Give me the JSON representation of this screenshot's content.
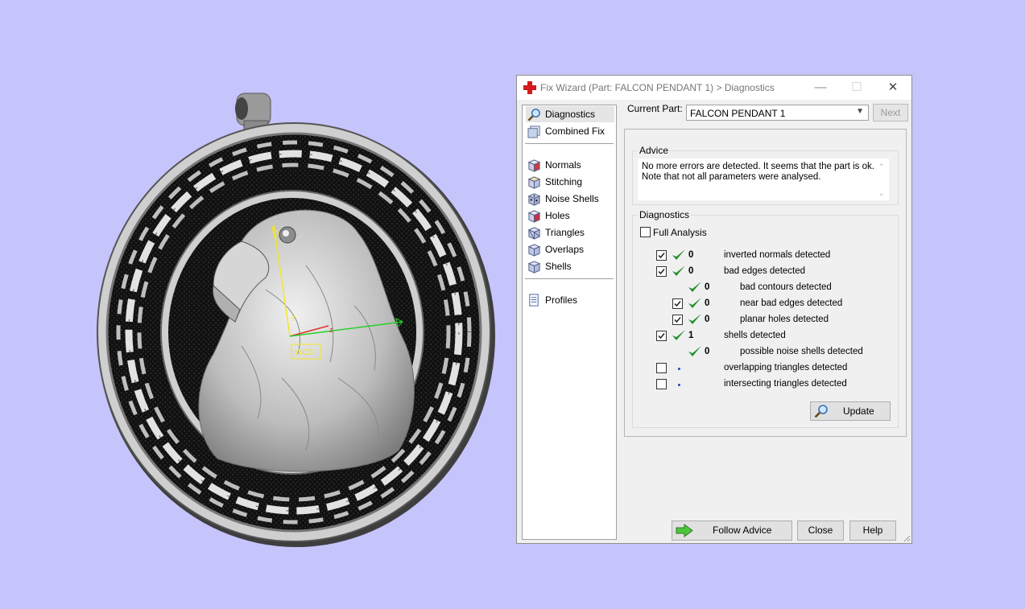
{
  "viewport": {
    "axis_label": "WCS",
    "colors": {
      "background": "#c5c4fb",
      "axis_x": "#e03030",
      "axis_y": "#f2e62a",
      "axis_z": "#29d029"
    }
  },
  "dialog": {
    "title": "Fix Wizard (Part: FALCON PENDANT 1) > Diagnostics",
    "window_buttons": {
      "minimize": "—",
      "maximize": "☐",
      "close": "✕"
    },
    "sidebar": {
      "items": [
        {
          "label": "Diagnostics",
          "icon": "magnifier-icon",
          "selected": true
        },
        {
          "label": "Combined Fix",
          "icon": "combined-fix-icon"
        },
        {
          "label": "Normals",
          "icon": "normals-cube-icon"
        },
        {
          "label": "Stitching",
          "icon": "stitching-cube-icon"
        },
        {
          "label": "Noise Shells",
          "icon": "noise-shells-icon"
        },
        {
          "label": "Holes",
          "icon": "holes-cube-icon"
        },
        {
          "label": "Triangles",
          "icon": "triangles-cube-icon"
        },
        {
          "label": "Overlaps",
          "icon": "overlaps-cube-icon"
        },
        {
          "label": "Shells",
          "icon": "shells-cube-icon"
        },
        {
          "label": "Profiles",
          "icon": "profiles-page-icon"
        }
      ]
    },
    "current_part_label": "Current Part:",
    "current_part_value": "FALCON PENDANT 1",
    "next_label": "Next",
    "advice": {
      "legend": "Advice",
      "lines": [
        "No more errors are detected. It seems that the part is ok.",
        "Note that not all parameters were analysed."
      ]
    },
    "diagnostics": {
      "legend": "Diagnostics",
      "full_analysis_label": "Full Analysis",
      "full_analysis_checked": false,
      "rows": [
        {
          "checked": true,
          "status": "ok",
          "count": "0",
          "text": "inverted normals detected"
        },
        {
          "checked": true,
          "status": "ok",
          "count": "0",
          "text": "bad edges detected"
        },
        {
          "checked": null,
          "status": "ok",
          "count": "0",
          "text": "bad contours detected"
        },
        {
          "checked": true,
          "status": "ok",
          "count": "0",
          "text": "near bad edges detected"
        },
        {
          "checked": true,
          "status": "ok",
          "count": "0",
          "text": "planar holes detected"
        },
        {
          "checked": true,
          "status": "ok",
          "count": "1",
          "text": "shells detected"
        },
        {
          "checked": null,
          "status": "ok",
          "count": "0",
          "text": "possible noise shells detected"
        },
        {
          "checked": false,
          "status": "none",
          "count": "",
          "text": "overlapping triangles detected"
        },
        {
          "checked": false,
          "status": "none",
          "count": "",
          "text": "intersecting triangles detected"
        }
      ],
      "update_label": "Update"
    },
    "footer": {
      "follow_advice_label": "Follow Advice",
      "close_label": "Close",
      "help_label": "Help"
    }
  }
}
